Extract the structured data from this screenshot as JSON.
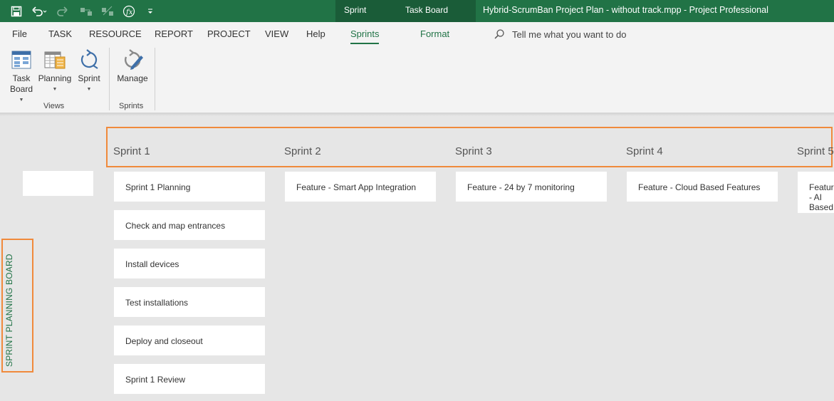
{
  "titlebar": {
    "context_tabs": [
      "Sprint Tools",
      "Task Board Tools"
    ],
    "document_title": "Hybrid-ScrumBan Project Plan - without track.mpp  -  Project Professional"
  },
  "menu": {
    "items": [
      "File",
      "TASK",
      "RESOURCE",
      "REPORT",
      "PROJECT",
      "VIEW",
      "Help",
      "Sprints",
      "Format"
    ],
    "active": "Sprints",
    "tell_me": "Tell me what you want to do"
  },
  "ribbon": {
    "views_group": {
      "label": "Views",
      "buttons": [
        {
          "line1": "Task",
          "line2": "Board"
        },
        {
          "line1": "Planning"
        },
        {
          "line1": "Sprint"
        }
      ]
    },
    "sprints_group": {
      "label": "Sprints",
      "buttons": [
        {
          "line1": "Manage"
        }
      ]
    }
  },
  "board": {
    "side_label": "SPRINT PLANNING BOARD",
    "columns": [
      {
        "title": "Sprint 1",
        "cards": [
          "Sprint 1 Planning",
          "Check and map entrances",
          "Install devices",
          "Test installations",
          "Deploy and closeout",
          "Sprint 1 Review"
        ]
      },
      {
        "title": "Sprint 2",
        "cards": [
          "Feature - Smart App Integration"
        ]
      },
      {
        "title": "Sprint 3",
        "cards": [
          "Feature - 24 by 7 monitoring"
        ]
      },
      {
        "title": "Sprint 4",
        "cards": [
          "Feature - Cloud Based Features"
        ]
      },
      {
        "title": "Sprint 5",
        "cards": [
          "Feature - AI Based features"
        ]
      }
    ]
  },
  "colors": {
    "accent": "#217346",
    "highlight": "#f08a3c",
    "board_bg": "#e6e6e6"
  }
}
